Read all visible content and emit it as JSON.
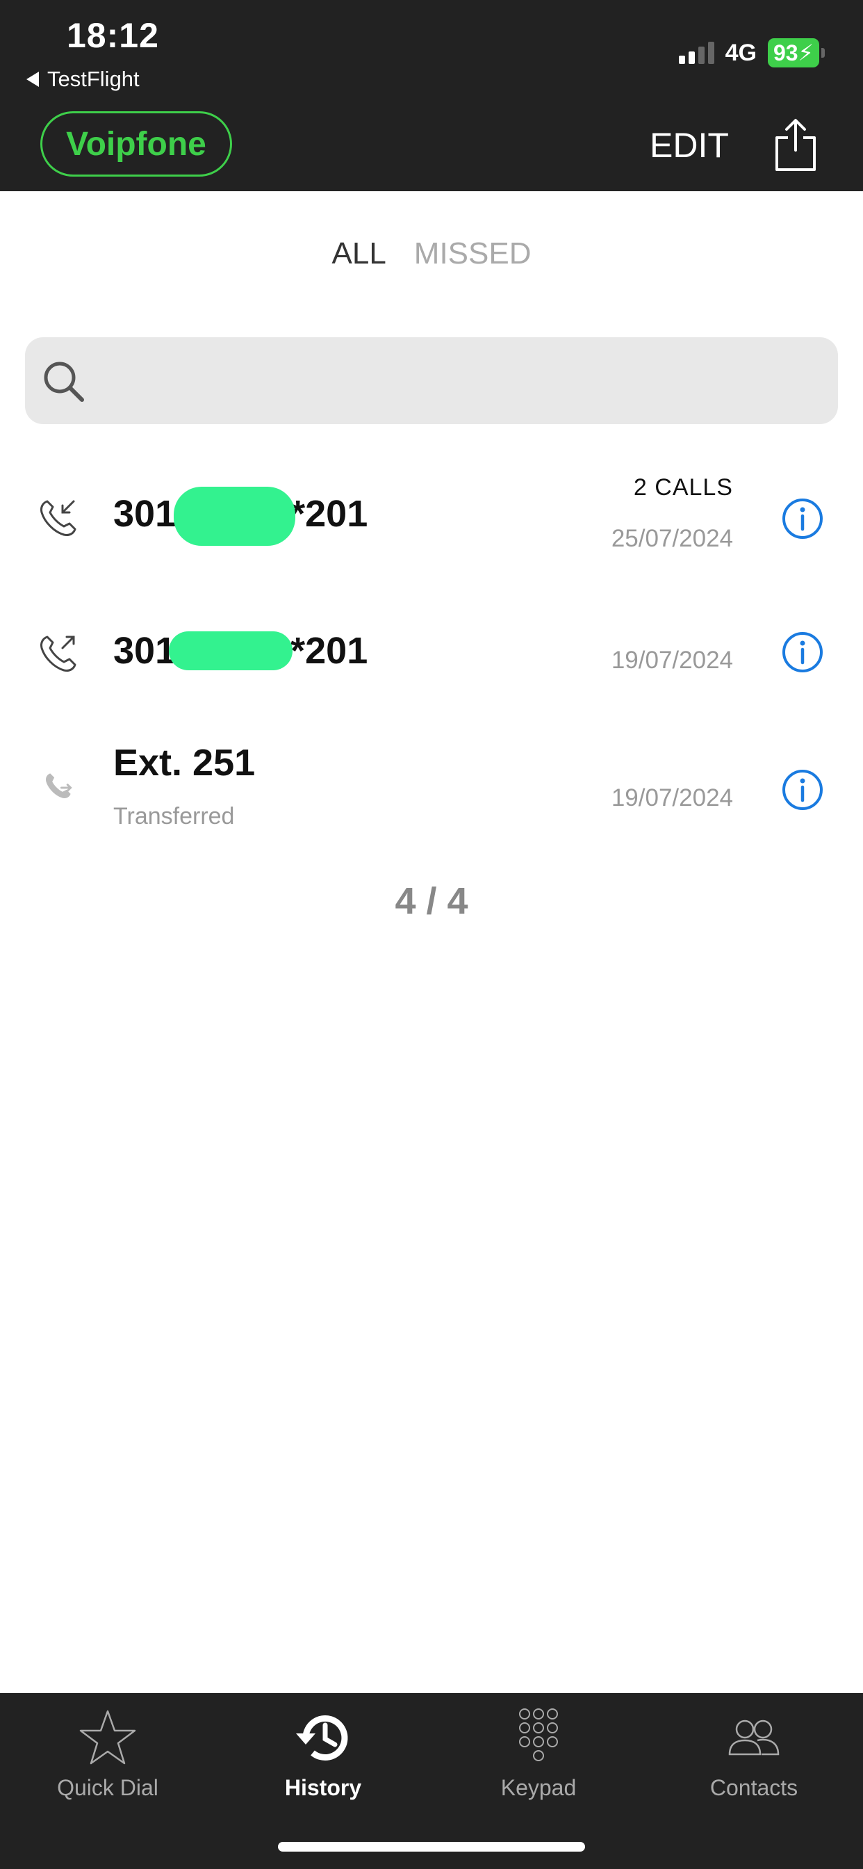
{
  "status_bar": {
    "time": "18:12",
    "back_app": "TestFlight",
    "network": "4G",
    "battery": "93"
  },
  "header": {
    "brand": "Voipfone",
    "edit_label": "EDIT"
  },
  "filter_tabs": {
    "all": "ALL",
    "missed": "MISSED"
  },
  "search": {
    "placeholder": ""
  },
  "calls": [
    {
      "name_prefix": "301",
      "name_suffix": "*201",
      "count": "2 CALLS",
      "date": "25/07/2024",
      "direction": "incoming"
    },
    {
      "name_prefix": "301",
      "name_suffix": "*201",
      "count": "",
      "date": "19/07/2024",
      "direction": "outgoing"
    },
    {
      "name": "Ext. 251",
      "subtitle": "Transferred",
      "date": "19/07/2024",
      "direction": "transferred"
    }
  ],
  "pager": "4 / 4",
  "tabbar": [
    {
      "label": "Quick Dial",
      "icon": "star-icon"
    },
    {
      "label": "History",
      "icon": "history-icon",
      "active": true
    },
    {
      "label": "Keypad",
      "icon": "keypad-icon"
    },
    {
      "label": "Contacts",
      "icon": "contacts-icon"
    }
  ],
  "colors": {
    "brand_green": "#3ecf4a",
    "info_blue": "#1a7be0",
    "header_bg": "#222222"
  }
}
